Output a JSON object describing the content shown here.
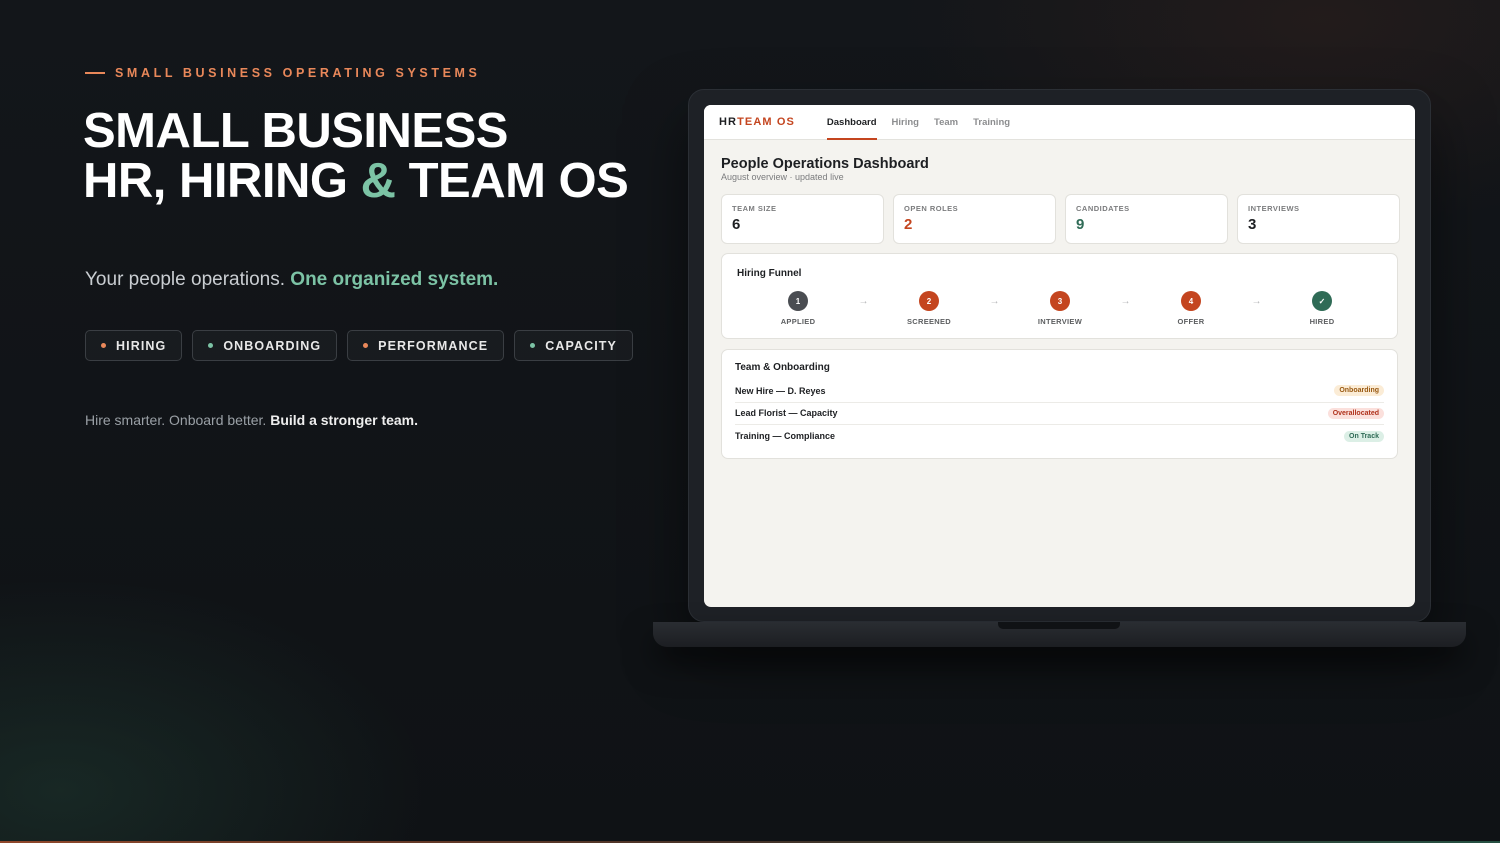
{
  "hero": {
    "eyebrow": "SMALL BUSINESS OPERATING SYSTEMS",
    "headline_line1": "SMALL BUSINESS",
    "headline_line2_a": "HR, HIRING ",
    "headline_amp": "&",
    "headline_line2_b": " TEAM OS",
    "subline_plain": "Your people operations. ",
    "subline_accent": "One organized system.",
    "chips": [
      {
        "label": "HIRING",
        "dot_color": "#e9885a"
      },
      {
        "label": "ONBOARDING",
        "dot_color": "#7cc3a5"
      },
      {
        "label": "PERFORMANCE",
        "dot_color": "#e9885a"
      },
      {
        "label": "CAPACITY",
        "dot_color": "#7cc3a5"
      }
    ],
    "tagline_plain": "Hire smarter. Onboard better. ",
    "tagline_bold": "Build a stronger team."
  },
  "app": {
    "brand_a": "HR",
    "brand_b": "TEAM OS",
    "tabs": [
      "Dashboard",
      "Hiring",
      "Team",
      "Training"
    ],
    "active_tab": "Dashboard",
    "page_title": "People Operations Dashboard",
    "page_subtitle": "August overview · updated live",
    "stats": [
      {
        "label": "TEAM SIZE",
        "value": "6",
        "color": "#1d1f22"
      },
      {
        "label": "OPEN ROLES",
        "value": "2",
        "color": "#c4451f"
      },
      {
        "label": "CANDIDATES",
        "value": "9",
        "color": "#2f6b56"
      },
      {
        "label": "INTERVIEWS",
        "value": "3",
        "color": "#1d1f22"
      }
    ],
    "funnel": {
      "title": "Hiring Funnel",
      "arrow": "→",
      "steps": [
        {
          "num": "1",
          "label": "APPLIED",
          "color": "#4a4d52"
        },
        {
          "num": "2",
          "label": "SCREENED",
          "color": "#c4451f"
        },
        {
          "num": "3",
          "label": "INTERVIEW",
          "color": "#c4451f"
        },
        {
          "num": "4",
          "label": "OFFER",
          "color": "#c4451f"
        },
        {
          "num": "✓",
          "label": "HIRED",
          "color": "#2f6b56"
        }
      ]
    },
    "team": {
      "title": "Team & Onboarding",
      "rows": [
        {
          "name": "New Hire — D. Reyes",
          "status": "Onboarding",
          "bg": "#fbecd6",
          "fg": "#9a5a12"
        },
        {
          "name": "Lead Florist — Capacity",
          "status": "Overallocated",
          "bg": "#fbe0dc",
          "fg": "#b0321c"
        },
        {
          "name": "Training — Compliance",
          "status": "On Track",
          "bg": "#dcefe6",
          "fg": "#2f6b56"
        }
      ]
    }
  }
}
